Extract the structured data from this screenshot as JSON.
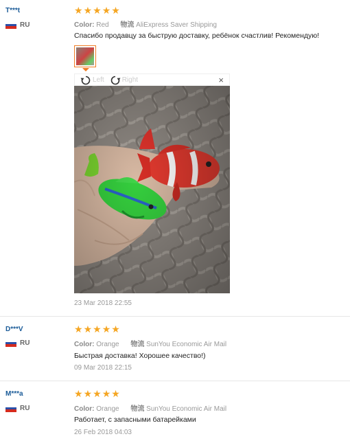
{
  "reviews": [
    {
      "user": "T***t",
      "country": "RU",
      "stars": 5,
      "color_label": "Color:",
      "color_value": "Red",
      "ship_label": "物流",
      "ship_value": "AliExpress Saver Shipping",
      "text": "Спасибо продавцу за быструю доставку, ребёнок счастлив! Рекомендую!",
      "date": "23 Mar 2018 22:55"
    },
    {
      "user": "D***V",
      "country": "RU",
      "stars": 5,
      "color_label": "Color:",
      "color_value": "Orange",
      "ship_label": "物流",
      "ship_value": "SunYou Economic Air Mail",
      "text": "Быстрая доставка! Хорошее качество!)",
      "date": "09 Mar 2018 22:15"
    },
    {
      "user": "M***a",
      "country": "RU",
      "stars": 5,
      "color_label": "Color:",
      "color_value": "Orange",
      "ship_label": "物流",
      "ship_value": "SunYou Economic Air Mail",
      "text": "Работает, с запасными батарейками",
      "date": "26 Feb 2018 04:03"
    }
  ],
  "viewer": {
    "rotate_left": "Left",
    "rotate_right": "Right",
    "close": "×"
  },
  "colors": {
    "star": "#f5a623",
    "username": "#1a5b98",
    "thumb_border": "#f07c23"
  }
}
